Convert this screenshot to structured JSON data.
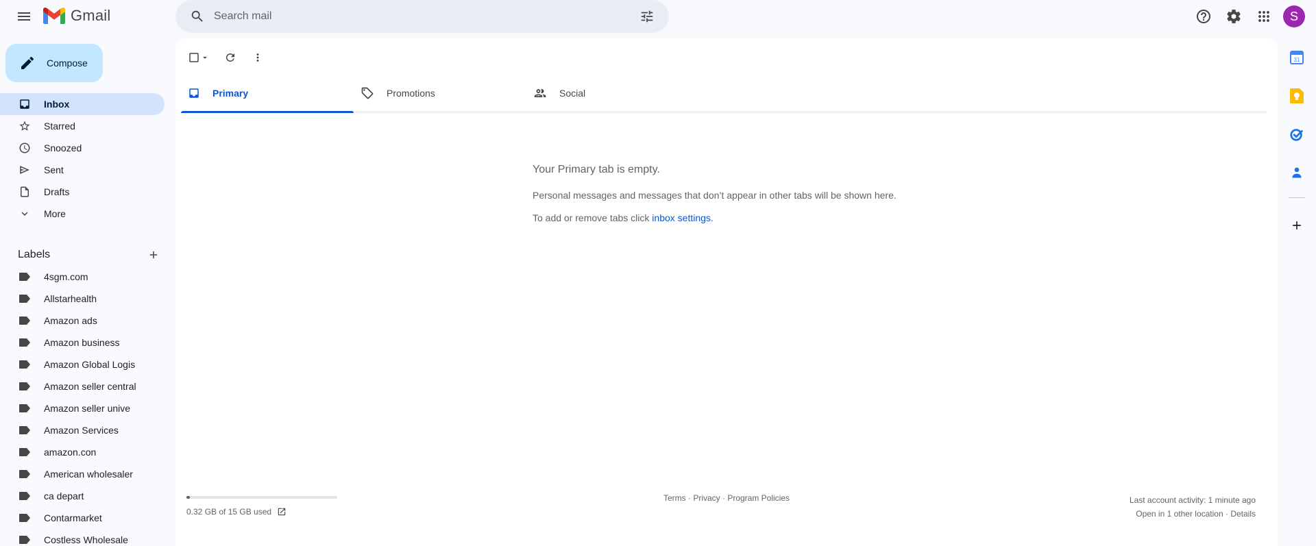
{
  "app": {
    "name": "Gmail",
    "brand_colors": [
      "#ea4335",
      "#4285f4",
      "#34a853",
      "#fbbc04",
      "#c5221f"
    ]
  },
  "search": {
    "placeholder": "Search mail"
  },
  "account": {
    "avatar_letter": "S",
    "avatar_color": "#9c27b0"
  },
  "compose": {
    "label": "Compose"
  },
  "nav": {
    "items": [
      {
        "label": "Inbox",
        "icon": "inbox-icon",
        "active": true
      },
      {
        "label": "Starred",
        "icon": "star-icon"
      },
      {
        "label": "Snoozed",
        "icon": "clock-icon"
      },
      {
        "label": "Sent",
        "icon": "send-icon"
      },
      {
        "label": "Drafts",
        "icon": "draft-icon"
      },
      {
        "label": "More",
        "icon": "chevron-down-icon"
      }
    ]
  },
  "labels": {
    "title": "Labels",
    "items": [
      "4sgm.com",
      "Allstarhealth",
      "Amazon ads",
      "Amazon business",
      "Amazon Global Logis",
      "Amazon seller central",
      "Amazon seller unive",
      "Amazon Services",
      "amazon.con",
      "American wholesaler",
      "ca depart",
      "Contarmarket",
      "Costless Wholesale"
    ]
  },
  "tabs": [
    {
      "label": "Primary",
      "icon": "inbox-icon",
      "active": true
    },
    {
      "label": "Promotions",
      "icon": "tag-icon"
    },
    {
      "label": "Social",
      "icon": "people-icon"
    }
  ],
  "empty_state": {
    "title": "Your Primary tab is empty.",
    "line1": "Personal messages and messages that don’t appear in other tabs will be shown here.",
    "line2_prefix": "To add or remove tabs click ",
    "line2_link": "inbox settings",
    "line2_suffix": "."
  },
  "footer": {
    "storage_text": "0.32 GB of 15 GB used",
    "storage_fraction": 0.021,
    "policies": "Terms · Privacy · Program Policies",
    "activity_line1": "Last account activity: 1 minute ago",
    "activity_line2": "Open in 1 other location · Details"
  },
  "side_panel": {
    "icons": [
      "calendar-icon",
      "keep-icon",
      "tasks-icon",
      "contacts-icon",
      "add-icon"
    ]
  }
}
